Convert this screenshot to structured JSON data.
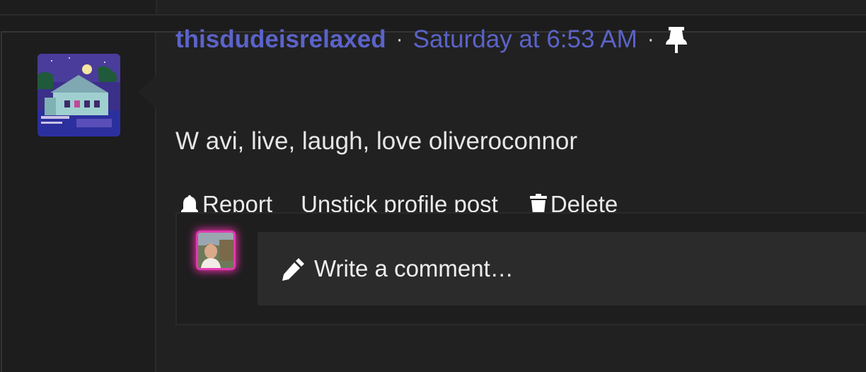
{
  "post": {
    "username": "thisdudeisrelaxed",
    "separator": "·",
    "timestamp": "Saturday at 6:53 AM",
    "pinned_icon": "thumbtack-icon",
    "message": "W avi, live, laugh, love oliveroconnor",
    "avatar_icon": "house-night-avatar"
  },
  "actions": {
    "report_label": "Report",
    "report_icon": "bell-icon",
    "unstick_label": "Unstick profile post",
    "delete_label": "Delete",
    "delete_icon": "trash-icon"
  },
  "comment": {
    "placeholder": "Write a comment…",
    "pencil_icon": "pencil-icon"
  },
  "colors": {
    "accent": "#5b63c9",
    "avatar_glow": "#ff2fb7",
    "background": "#212121",
    "text": "#e6e6e6"
  }
}
